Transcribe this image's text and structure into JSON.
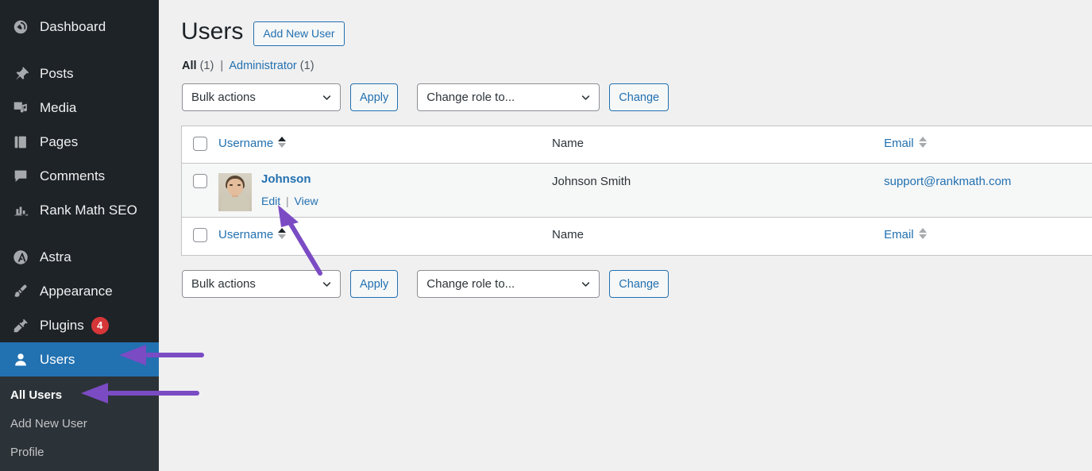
{
  "sidebar": {
    "items": [
      {
        "label": "Dashboard",
        "icon": "dashboard-icon",
        "current": false,
        "badge": null
      },
      {
        "label": "Posts",
        "icon": "pin-icon",
        "current": false,
        "badge": null
      },
      {
        "label": "Media",
        "icon": "media-icon",
        "current": false,
        "badge": null
      },
      {
        "label": "Pages",
        "icon": "pages-icon",
        "current": false,
        "badge": null
      },
      {
        "label": "Comments",
        "icon": "comments-icon",
        "current": false,
        "badge": null
      },
      {
        "label": "Rank Math SEO",
        "icon": "rank-math-icon",
        "current": false,
        "badge": null
      },
      {
        "label": "Astra",
        "icon": "astra-icon",
        "current": false,
        "badge": null
      },
      {
        "label": "Appearance",
        "icon": "appearance-icon",
        "current": false,
        "badge": null
      },
      {
        "label": "Plugins",
        "icon": "plugins-icon",
        "current": false,
        "badge": "4"
      },
      {
        "label": "Users",
        "icon": "users-icon",
        "current": true,
        "badge": null
      }
    ],
    "submenu": [
      {
        "label": "All Users",
        "current": true
      },
      {
        "label": "Add New User",
        "current": false
      },
      {
        "label": "Profile",
        "current": false
      }
    ],
    "colors": {
      "background": "#1d2327",
      "submenu_background": "#2c3338",
      "active": "#2271b1",
      "badge": "#d63638"
    }
  },
  "header": {
    "title": "Users",
    "add_new_button": "Add New User"
  },
  "filters": {
    "all_label": "All",
    "all_count": "(1)",
    "separator": "|",
    "administrator_label": "Administrator",
    "administrator_count": "(1)"
  },
  "toolbar_top": {
    "bulk_actions_value": "Bulk actions",
    "apply_label": "Apply",
    "change_role_value": "Change role to...",
    "change_label": "Change"
  },
  "toolbar_bottom": {
    "bulk_actions_value": "Bulk actions",
    "apply_label": "Apply",
    "change_role_value": "Change role to...",
    "change_label": "Change"
  },
  "table": {
    "columns": {
      "username": "Username",
      "name": "Name",
      "email": "Email"
    },
    "sort": {
      "column": "username",
      "direction": "asc"
    },
    "rows": [
      {
        "username": "Johnson",
        "name": "Johnson Smith",
        "email": "support@rankmath.com",
        "actions": {
          "edit": "Edit",
          "separator": "|",
          "view": "View"
        }
      }
    ]
  },
  "annotations": {
    "color": "#7b4bc4",
    "arrows": [
      {
        "name": "arrow-to-users-menu",
        "direction": "left"
      },
      {
        "name": "arrow-to-all-users-menu",
        "direction": "left"
      },
      {
        "name": "arrow-to-edit-link",
        "direction": "up-left"
      }
    ]
  },
  "colors": {
    "content_background": "#f0f0f1",
    "link": "#2271b1",
    "table_background": "#ffffff",
    "row_background": "#f6f7f7"
  }
}
